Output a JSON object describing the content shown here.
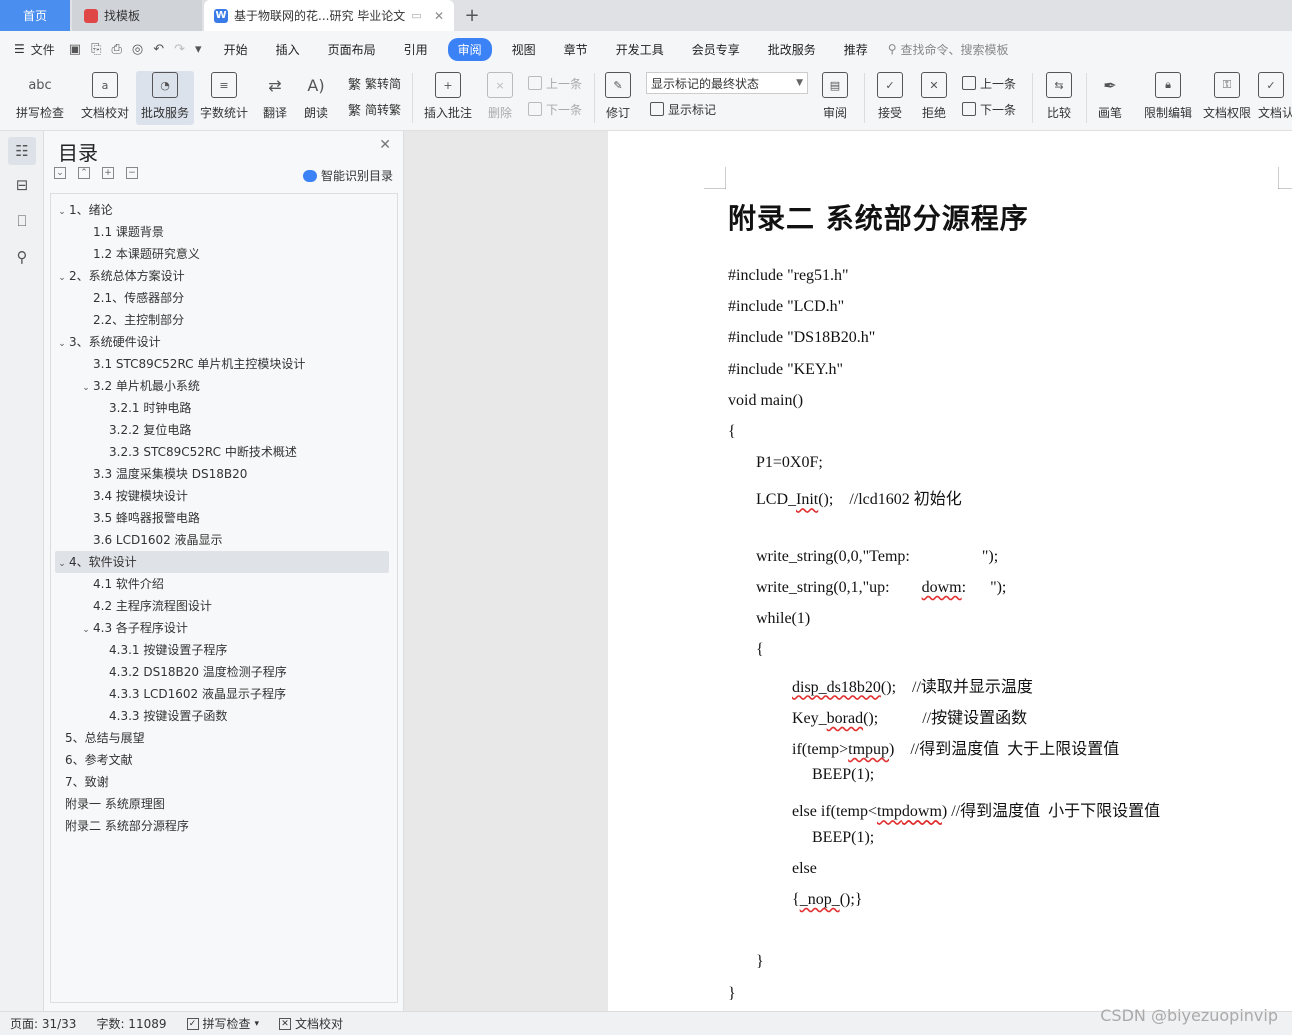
{
  "tabs": {
    "home": "首页",
    "template": "找模板",
    "doc": "基于物联网的花...研究 毕业论文"
  },
  "menu": {
    "file": "文件",
    "items": [
      "开始",
      "插入",
      "页面布局",
      "引用",
      "审阅",
      "视图",
      "章节",
      "开发工具",
      "会员专享",
      "批改服务",
      "推荐"
    ],
    "search": "查找命令、搜索模板"
  },
  "ribbon": {
    "spell": "拼写检查",
    "spell_icon_text": "abc",
    "proof": "文档校对",
    "grade": "批改服务",
    "count": "字数统计",
    "translate": "翻译",
    "read": "朗读",
    "trad": "繁转简",
    "simp": "简转繁",
    "insert_comment": "插入批注",
    "delete": "删除",
    "prev": "上一条",
    "next": "下一条",
    "revise": "修订",
    "mark_state": "显示标记的最终状态",
    "show_mark": "显示标记",
    "review": "审阅",
    "accept": "接受",
    "reject": "拒绝",
    "prev2": "上一条",
    "next2": "下一条",
    "compare": "比较",
    "pen": "画笔",
    "restrict": "限制编辑",
    "perm": "文档权限",
    "doc_cert": "文档认"
  },
  "toc": {
    "title": "目录",
    "smart": "智能识别目录",
    "items": [
      {
        "t": "1、绪论",
        "lvl": 1,
        "c": "v"
      },
      {
        "t": "1.1 课题背景",
        "lvl": 2
      },
      {
        "t": "1.2  本课题研究意义",
        "lvl": 2
      },
      {
        "t": "2、系统总体方案设计",
        "lvl": 1,
        "c": "v"
      },
      {
        "t": "2.1、传感器部分",
        "lvl": 2
      },
      {
        "t": "2.2、主控制部分",
        "lvl": 2
      },
      {
        "t": "3、系统硬件设计",
        "lvl": 1,
        "c": "v"
      },
      {
        "t": "3.1 STC89C52RC 单片机主控模块设计",
        "lvl": 2
      },
      {
        "t": "3.2 单片机最小系统",
        "lvl": 2,
        "c": "v"
      },
      {
        "t": "3.2.1 时钟电路",
        "lvl": 3
      },
      {
        "t": "3.2.2 复位电路",
        "lvl": 3
      },
      {
        "t": "3.2.3 STC89C52RC 中断技术概述",
        "lvl": 3
      },
      {
        "t": "3.3  温度采集模块 DS18B20",
        "lvl": 2
      },
      {
        "t": "3.4 按键模块设计",
        "lvl": 2
      },
      {
        "t": "3.5 蜂鸣器报警电路",
        "lvl": 2
      },
      {
        "t": "3.6 LCD1602 液晶显示",
        "lvl": 2
      },
      {
        "t": "4、软件设计",
        "lvl": 1,
        "c": "v",
        "sel": true
      },
      {
        "t": "4.1 软件介绍",
        "lvl": 2
      },
      {
        "t": "4.2  主程序流程图设计",
        "lvl": 2
      },
      {
        "t": "4.3 各子程序设计",
        "lvl": 2,
        "c": "v"
      },
      {
        "t": "4.3.1 按键设置子程序",
        "lvl": 3
      },
      {
        "t": "4.3.2 DS18B20 温度检测子程序",
        "lvl": 3
      },
      {
        "t": "4.3.3 LCD1602 液晶显示子程序",
        "lvl": 3
      },
      {
        "t": "4.3.3  按键设置子函数",
        "lvl": 3
      },
      {
        "t": "5、总结与展望",
        "lvl": 1
      },
      {
        "t": "6、参考文献",
        "lvl": 1
      },
      {
        "t": "7、致谢",
        "lvl": 1
      },
      {
        "t": "附录一  系统原理图",
        "lvl": 1
      },
      {
        "t": "附录二  系统部分源程序",
        "lvl": 1
      }
    ]
  },
  "doc": {
    "heading": "附录二  系统部分源程序",
    "lines": [
      {
        "t": "#include \"reg51.h\"",
        "i": 0
      },
      {
        "t": "#include \"LCD.h\"",
        "i": 0
      },
      {
        "t": "#include \"DS18B20.h\"",
        "i": 0
      },
      {
        "t": "#include \"KEY.h\"",
        "i": 0
      },
      {
        "t": "void main()",
        "i": 0
      },
      {
        "t": "{",
        "i": 0
      },
      {
        "t": "P1=0X0F;",
        "i": 1
      },
      {
        "t": "LCD_Init();    //lcd1602 初始化",
        "i": 1
      },
      {
        "t": "",
        "i": 1
      },
      {
        "t": "write_string(0,0,\"Temp:                  \");",
        "i": 1
      },
      {
        "t": "write_string(0,1,\"up:        dowm:      \");",
        "i": 1
      },
      {
        "t": "while(1)",
        "i": 1
      },
      {
        "t": "{",
        "i": 1
      },
      {
        "t": "disp_ds18b20();    //读取并显示温度",
        "i": 2
      },
      {
        "t": "Key_borad();           //按键设置函数",
        "i": 2
      },
      {
        "t": "if(temp>tmpup)    //得到温度值  大于上限设置值",
        "i": 2
      },
      {
        "t": "BEEP(1);",
        "i": 3
      },
      {
        "t": "else if(temp<tmpdowm) //得到温度值  小于下限设置值",
        "i": 2
      },
      {
        "t": "BEEP(1);",
        "i": 3
      },
      {
        "t": "else",
        "i": 2
      },
      {
        "t": "{_nop_();}",
        "i": 2
      },
      {
        "t": "",
        "i": 2
      },
      {
        "t": "}",
        "i": 1
      },
      {
        "t": "}",
        "i": 0
      }
    ]
  },
  "status": {
    "page": "页面: 31/33",
    "words": "字数: 11089",
    "spell": "拼写检查",
    "proof": "文档校对"
  },
  "watermark": "CSDN @biyezuopinvip"
}
